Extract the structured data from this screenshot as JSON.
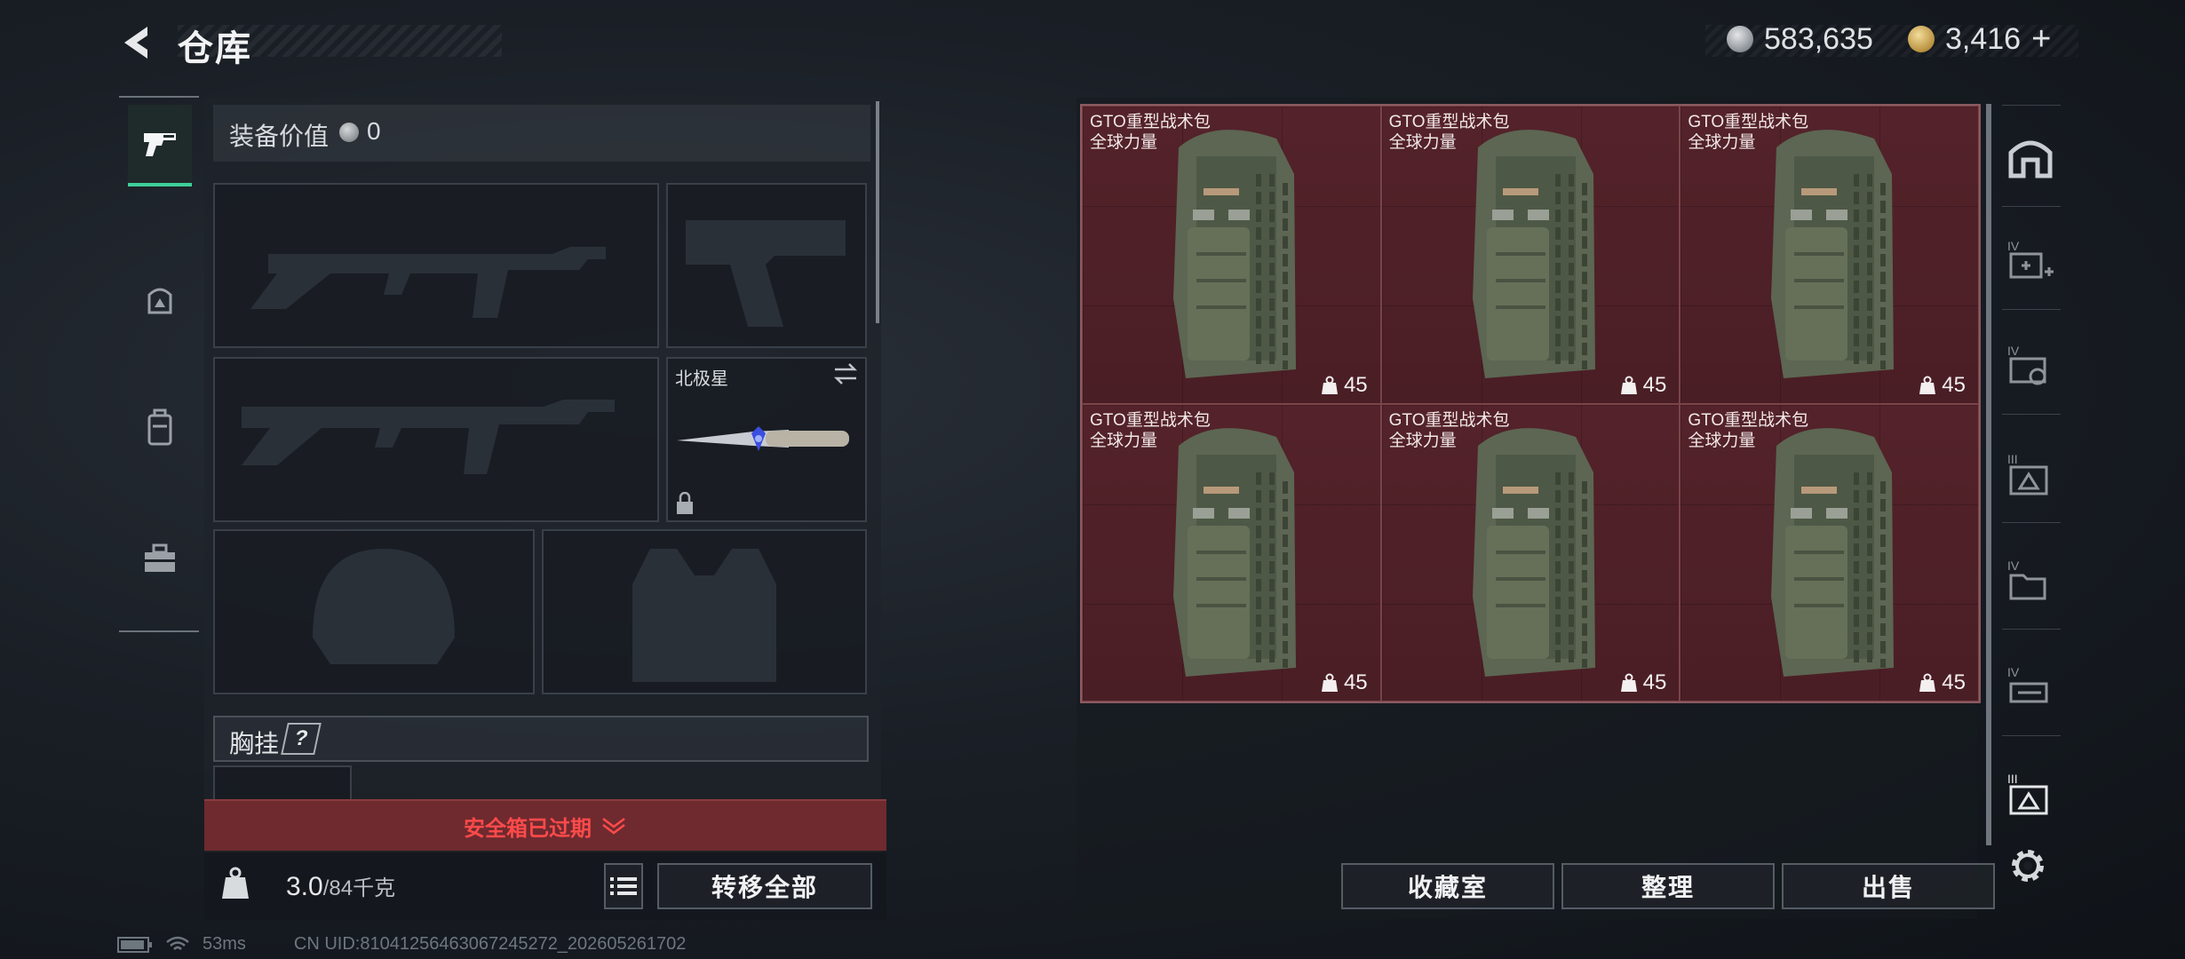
{
  "header": {
    "title": "仓库"
  },
  "currency": {
    "silver": "583,635",
    "gold": "3,416",
    "plus": "+"
  },
  "left_tabs": [
    {
      "name": "weapons-tab",
      "icon": "pistol-icon",
      "active": true
    },
    {
      "name": "gear-tab",
      "icon": "helmet-vest-icon",
      "active": false
    },
    {
      "name": "backpack-tab",
      "icon": "backpack-icon",
      "active": false
    },
    {
      "name": "toolbox-tab",
      "icon": "toolbox-icon",
      "active": false
    }
  ],
  "equipment": {
    "title": "装备价值",
    "value": "0",
    "melee_slot_name": "北极星",
    "chest_rig_label": "胸挂",
    "chest_rig_help": "?",
    "secure_box_status": "安全箱已过期",
    "weight_current": "3.0",
    "weight_max": "/84千克",
    "transfer_all_label": "转移全部"
  },
  "inventory_items": [
    {
      "name_line1": "GTO重型战术包",
      "name_line2": "全球力量",
      "count": "45"
    },
    {
      "name_line1": "GTO重型战术包",
      "name_line2": "全球力量",
      "count": "45"
    },
    {
      "name_line1": "GTO重型战术包",
      "name_line2": "全球力量",
      "count": "45"
    },
    {
      "name_line1": "GTO重型战术包",
      "name_line2": "全球力量",
      "count": "45"
    },
    {
      "name_line1": "GTO重型战术包",
      "name_line2": "全球力量",
      "count": "45"
    },
    {
      "name_line1": "GTO重型战术包",
      "name_line2": "全球力量",
      "count": "45"
    }
  ],
  "actions": {
    "collection": "收藏室",
    "sort": "整理",
    "sell": "出售"
  },
  "status_bar": {
    "ping": "53ms",
    "uid": "CN UID:8104125646306724527​2_202605261702"
  },
  "colors": {
    "accent": "#3fcf9a",
    "warning": "#ff4a4a",
    "grid_cell": "#4a1e25"
  }
}
